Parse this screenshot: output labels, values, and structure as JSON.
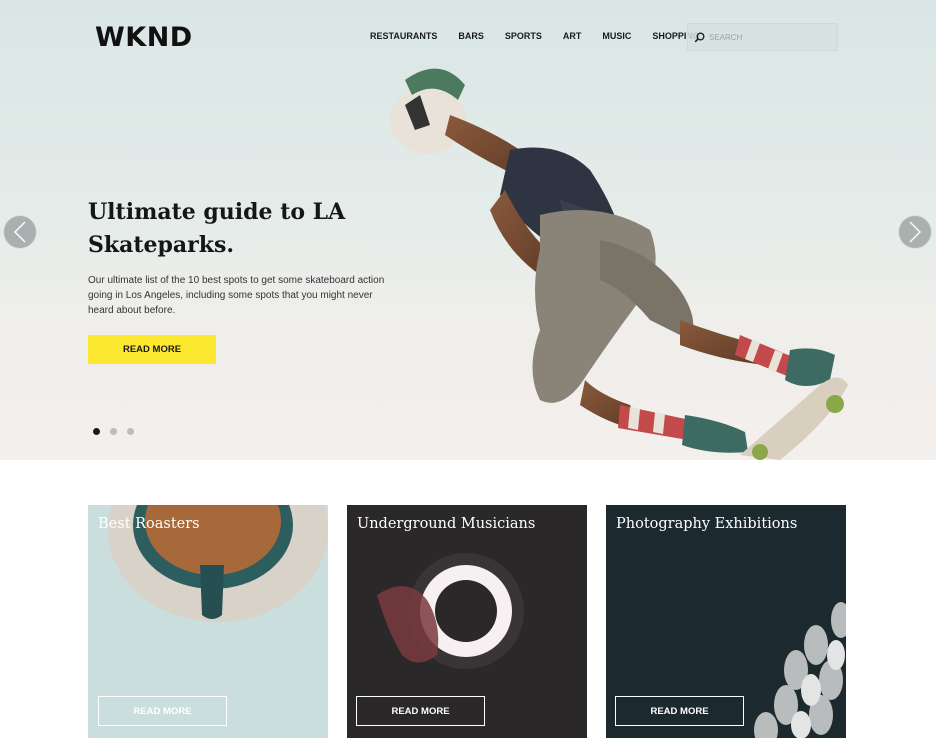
{
  "header": {
    "logo": "WKND",
    "nav": [
      "RESTAURANTS",
      "BARS",
      "SPORTS",
      "ART",
      "MUSIC",
      "SHOPPING"
    ],
    "search_placeholder": "SEARCH"
  },
  "hero": {
    "title": "Ultimate guide to LA Skateparks.",
    "description": "Our ultimate list of the 10 best spots to get some skateboard action going in Los Angeles, including some spots that you might never heard about before.",
    "button_label": "READ MORE",
    "slide_count": 3,
    "active_slide": 1
  },
  "cards": [
    {
      "title": "Best Roasters",
      "button_label": "READ MORE"
    },
    {
      "title": "Underground Musicians",
      "button_label": "READ MORE"
    },
    {
      "title": "Photography Exhibitions",
      "button_label": "READ MORE"
    }
  ],
  "colors": {
    "accent": "#fde830",
    "text": "#161616"
  },
  "icons": {
    "search": "search-icon",
    "prev": "chevron-left-icon",
    "next": "chevron-right-icon"
  }
}
